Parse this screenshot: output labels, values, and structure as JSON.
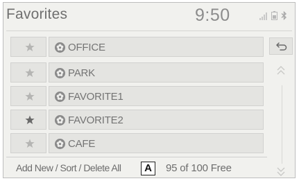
{
  "header": {
    "title": "Favorites",
    "time": "9:50"
  },
  "favorites": [
    {
      "name": "OFFICE",
      "starred": false
    },
    {
      "name": "PARK",
      "starred": false
    },
    {
      "name": "FAVORITE1",
      "starred": false
    },
    {
      "name": "FAVORITE2",
      "starred": true
    },
    {
      "name": "CAFE",
      "starred": false
    }
  ],
  "footer": {
    "manage_label": "Add New / Sort / Delete All",
    "callout": "A",
    "free_count": "95 of 100 Free"
  },
  "icons": {
    "star": "star-icon",
    "favorite": "favorite-flower-icon",
    "back": "back-arrow-icon",
    "scroll_up": "double-chevron-up-icon",
    "scroll_down": "double-chevron-down-icon",
    "signal": "signal-icon",
    "battery": "battery-icon",
    "bluetooth": "bluetooth-icon"
  },
  "colors": {
    "star_default": "#b5b5b3",
    "star_selected": "#6a6a6a",
    "screen_bg": "#f1f1ee",
    "button_bg": "#e4e4e1"
  }
}
